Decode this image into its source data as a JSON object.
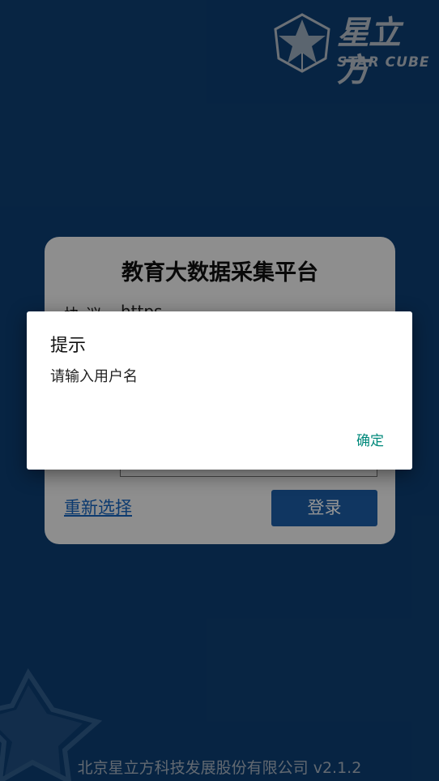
{
  "logo": {
    "name_cn": "星立方",
    "name_en": "STAR CUBE",
    "icon": "star-cube-logo-icon"
  },
  "card": {
    "title": "教育大数据采集平台",
    "protocol_label": "协 议",
    "protocol_value": "https",
    "reselect_link": "重新选择",
    "login_button": "登录"
  },
  "footer": {
    "text": "北京星立方科技发展股份有限公司 v2.1.2"
  },
  "dialog": {
    "title": "提示",
    "message": "请输入用户名",
    "ok_button": "确定"
  },
  "colors": {
    "background": "#0d3f74",
    "card": "#f4f4f4",
    "login_button": "#1c5ea8",
    "dialog_ok": "#00897b",
    "link": "#1565c0"
  }
}
